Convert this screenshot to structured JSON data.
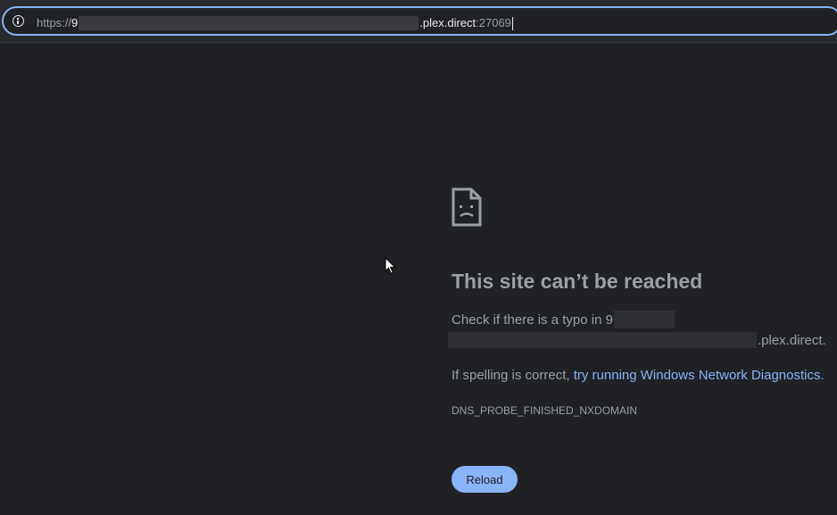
{
  "omnibox": {
    "scheme": "https://",
    "host_start": "9",
    "domain": ".plex.direct",
    "port": ":27069"
  },
  "error": {
    "title": "This site can’t be reached",
    "typo_prefix": "Check if there is a typo in 9",
    "typo_domain": ".plex.direct.",
    "spelling_prefix": "If spelling is correct, ",
    "diagnostics_link": "try running Windows Network Diagnostics",
    "spelling_suffix": ".",
    "code": "DNS_PROBE_FINISHED_NXDOMAIN",
    "reload_label": "Reload"
  },
  "colors": {
    "background": "#202124",
    "accent": "#8ab4f8",
    "text_secondary": "#9aa0a6"
  },
  "icons": {
    "omnibox": "info-icon",
    "error": "sad-page-icon",
    "pointer": "mouse-cursor-icon"
  }
}
